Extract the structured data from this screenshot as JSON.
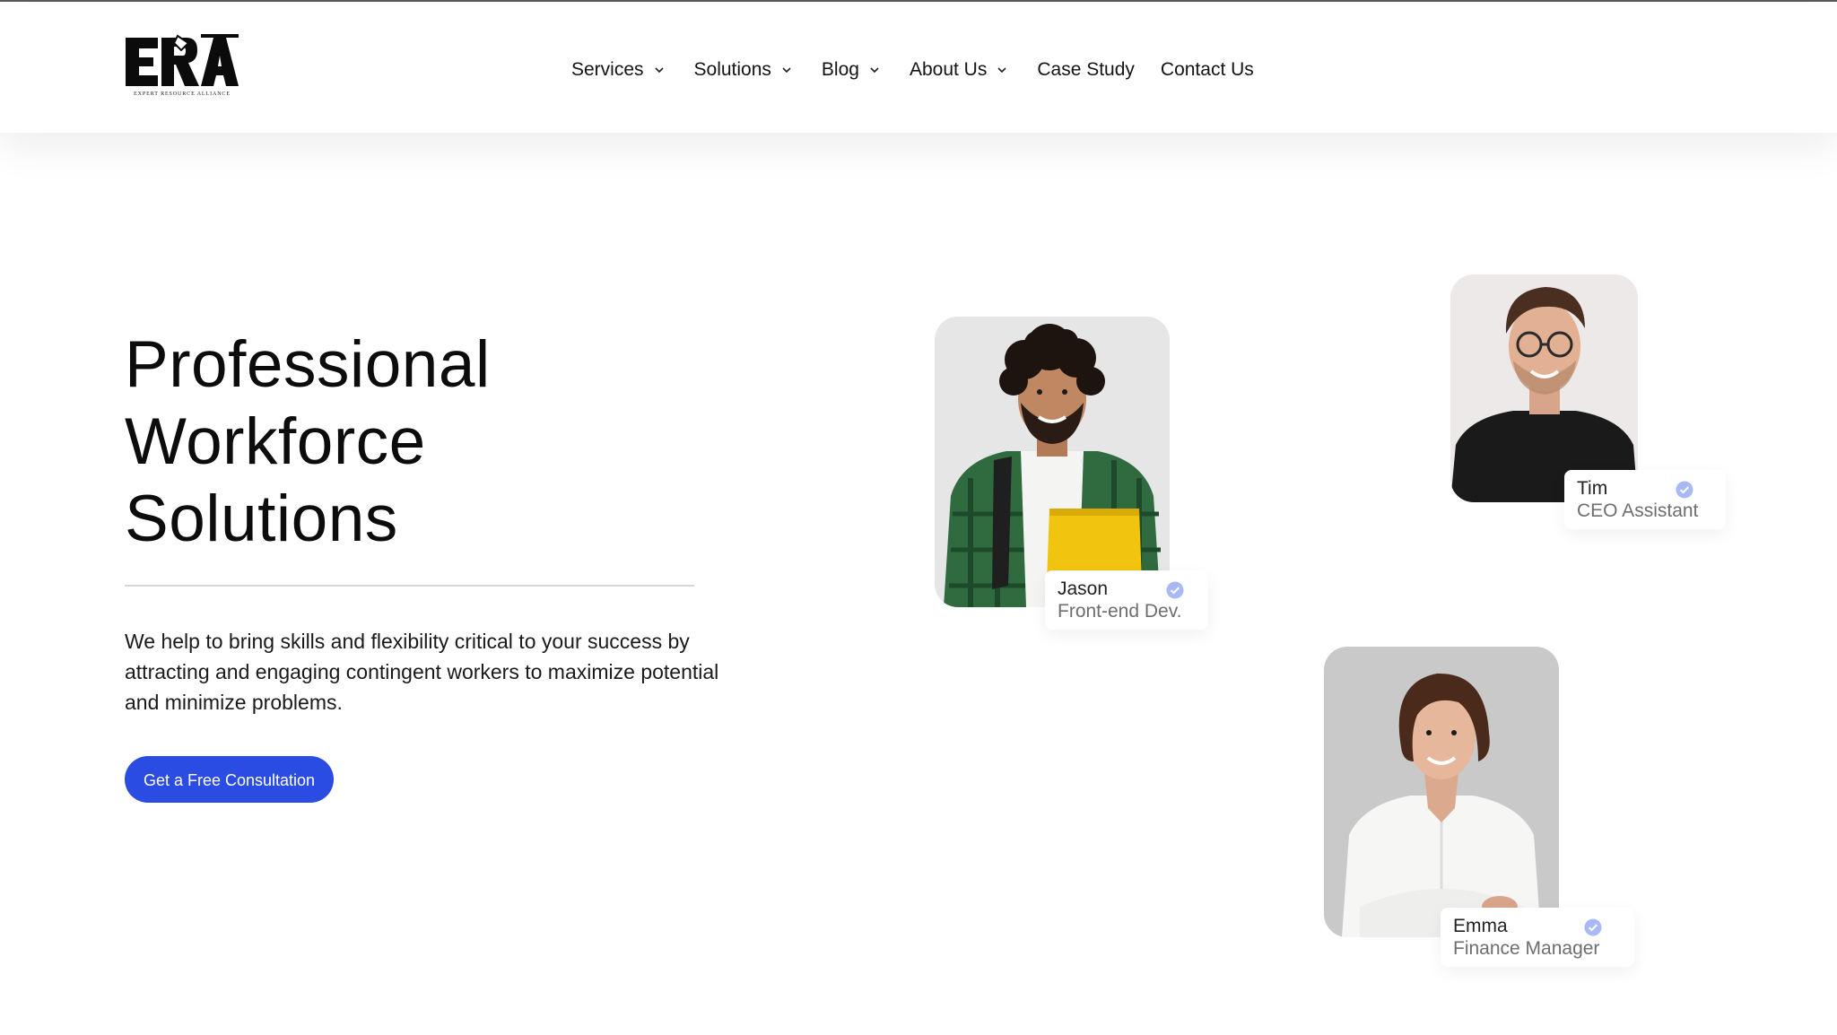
{
  "header": {
    "logo_text": "ERA",
    "logo_tagline": "EXPERT RESOURCE ALLIANCE",
    "nav": [
      {
        "label": "Services",
        "has_dropdown": true
      },
      {
        "label": "Solutions",
        "has_dropdown": true
      },
      {
        "label": "Blog",
        "has_dropdown": true
      },
      {
        "label": "About Us",
        "has_dropdown": true
      },
      {
        "label": "Case Study",
        "has_dropdown": false
      },
      {
        "label": "Contact Us",
        "has_dropdown": false
      }
    ]
  },
  "hero": {
    "title_line1": "Professional",
    "title_line2": "Workforce",
    "title_line3": "Solutions",
    "description": "We help to bring skills and flexibility critical to your success by attracting and engaging contingent workers to maximize potential and minimize problems.",
    "cta_label": "Get a Free Consultation"
  },
  "profiles": [
    {
      "name": "Jason",
      "role": "Front-end Dev.",
      "verified_icon": "check-badge-icon"
    },
    {
      "name": "Tim",
      "role": "CEO Assistant",
      "verified_icon": "check-badge-icon"
    },
    {
      "name": "Emma",
      "role": "Finance Manager",
      "verified_icon": "check-badge-icon"
    }
  ],
  "colors": {
    "accent": "#2b4ce3",
    "verified_badge": "#a9b9f5",
    "text_primary": "#0c0c0c"
  }
}
